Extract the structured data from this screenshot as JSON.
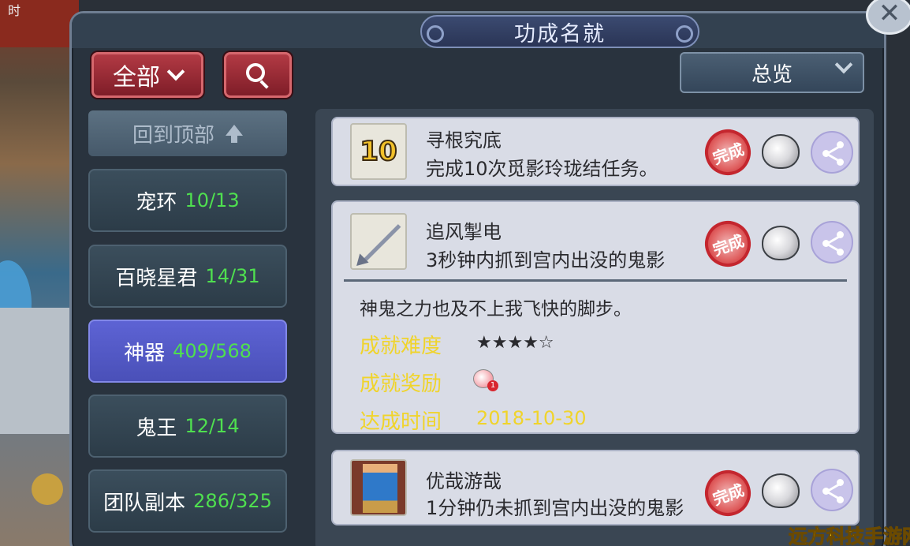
{
  "window": {
    "title": "功成名就",
    "close_label": "✕"
  },
  "toolbar": {
    "filter_label": "全部",
    "overview_label": "总览"
  },
  "sidebar": {
    "back_to_top": "回到顶部",
    "categories": [
      {
        "name": "宠环",
        "count": "10/13",
        "active": false
      },
      {
        "name": "百晓星君",
        "count": "14/31",
        "active": false
      },
      {
        "name": "神器",
        "count": "409/568",
        "active": true
      },
      {
        "name": "鬼王",
        "count": "12/14",
        "active": false
      },
      {
        "name": "团队副本",
        "count": "286/325",
        "active": false
      }
    ]
  },
  "achievements": [
    {
      "name": "寻根究底",
      "desc": "完成10次觅影玲珑结任务。",
      "icon": "ten-icon",
      "icon_text": "10",
      "status": "完成"
    },
    {
      "name": "追风掣电",
      "desc": "3秒钟内抓到宫内出没的鬼影",
      "icon": "arrow-icon",
      "status": "完成",
      "detail": {
        "flavor": "神鬼之力也及不上我飞快的脚步。",
        "difficulty_label": "成就难度",
        "difficulty_value": "★★★★☆",
        "reward_label": "成就奖励",
        "reward_badge": "1",
        "date_label": "达成时间",
        "date_value": "2018-10-30"
      }
    },
    {
      "name": "优哉游哉",
      "desc": "1分钟仍未抓到宫内出没的鬼影",
      "icon": "legs-icon",
      "status": "完成"
    }
  ],
  "background": {
    "corner_text": "时"
  },
  "watermark": "远方科技手游网",
  "colors": {
    "count_green": "#4fe04f",
    "label_yellow": "#f0d42b",
    "active_tab": "#5d63d4",
    "seal_red": "#c4262e"
  }
}
